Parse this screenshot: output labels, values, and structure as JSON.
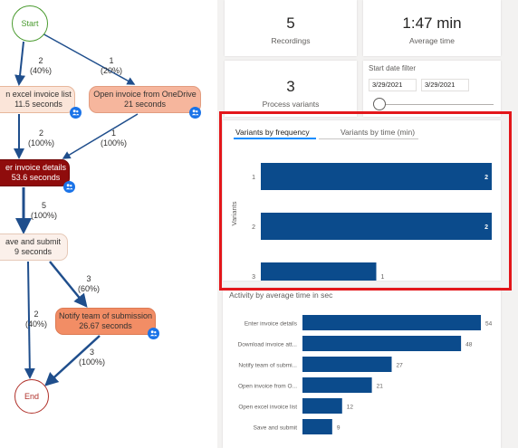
{
  "process_map": {
    "nodes": {
      "start": "Start",
      "end": "End",
      "excel": {
        "line1": "n excel invoice list",
        "line2": "11.5 seconds"
      },
      "onedrive": {
        "line1": "Open invoice from OneDrive",
        "line2": "21 seconds"
      },
      "enter": {
        "line1": "er invoice details",
        "line2": "53.6 seconds"
      },
      "save": {
        "line1": "ave and submit",
        "line2": "9 seconds"
      },
      "notify": {
        "line1": "Notify team of submission",
        "line2": "26.67 seconds"
      }
    },
    "edges": {
      "start_excel": {
        "count": "2",
        "pct": "(40%)"
      },
      "start_onedrive": {
        "count": "1",
        "pct": "(20%)"
      },
      "excel_enter": {
        "count": "2",
        "pct": "(100%)"
      },
      "onedrive_enter": {
        "count": "1",
        "pct": "(100%)"
      },
      "enter_save": {
        "count": "5",
        "pct": "(100%)"
      },
      "save_notify": {
        "count": "3",
        "pct": "(60%)"
      },
      "save_end": {
        "count": "2",
        "pct": "(40%)"
      },
      "notify_end": {
        "count": "3",
        "pct": "(100%)"
      }
    },
    "badge_icon": "people-icon"
  },
  "kpis": {
    "recordings": {
      "value": "5",
      "label": "Recordings"
    },
    "avg_time": {
      "value": "1:47 min",
      "label": "Average time"
    },
    "process_variants": {
      "value": "3",
      "label": "Process variants"
    }
  },
  "date_filter": {
    "title": "Start date filter",
    "start": "3/29/2021",
    "end": "3/29/2021"
  },
  "variants_card": {
    "tabs": [
      "Variants by frequency",
      "Variants by time (min)"
    ],
    "active_tab": 0
  },
  "activities_card": {
    "title": "Activity by average time in sec"
  },
  "colors": {
    "bar": "#0b4b8c",
    "highlight": "#e3161a",
    "start": "#4a9b2f",
    "end": "#b0312a"
  },
  "chart_data": [
    {
      "type": "bar",
      "orientation": "horizontal",
      "ylabel": "Variants",
      "categories": [
        "1",
        "2",
        "3"
      ],
      "values": [
        2,
        2,
        1
      ],
      "xlim": [
        0,
        2
      ]
    },
    {
      "type": "bar",
      "orientation": "horizontal",
      "title": "Activity by average time in sec",
      "categories": [
        "Enter invoice details",
        "Download invoice att...",
        "Notify team of submi...",
        "Open invoice from O...",
        "Open excel invoice list",
        "Save and submit"
      ],
      "values": [
        54,
        48,
        27,
        21,
        12,
        9
      ],
      "xlim": [
        0,
        54
      ]
    }
  ]
}
